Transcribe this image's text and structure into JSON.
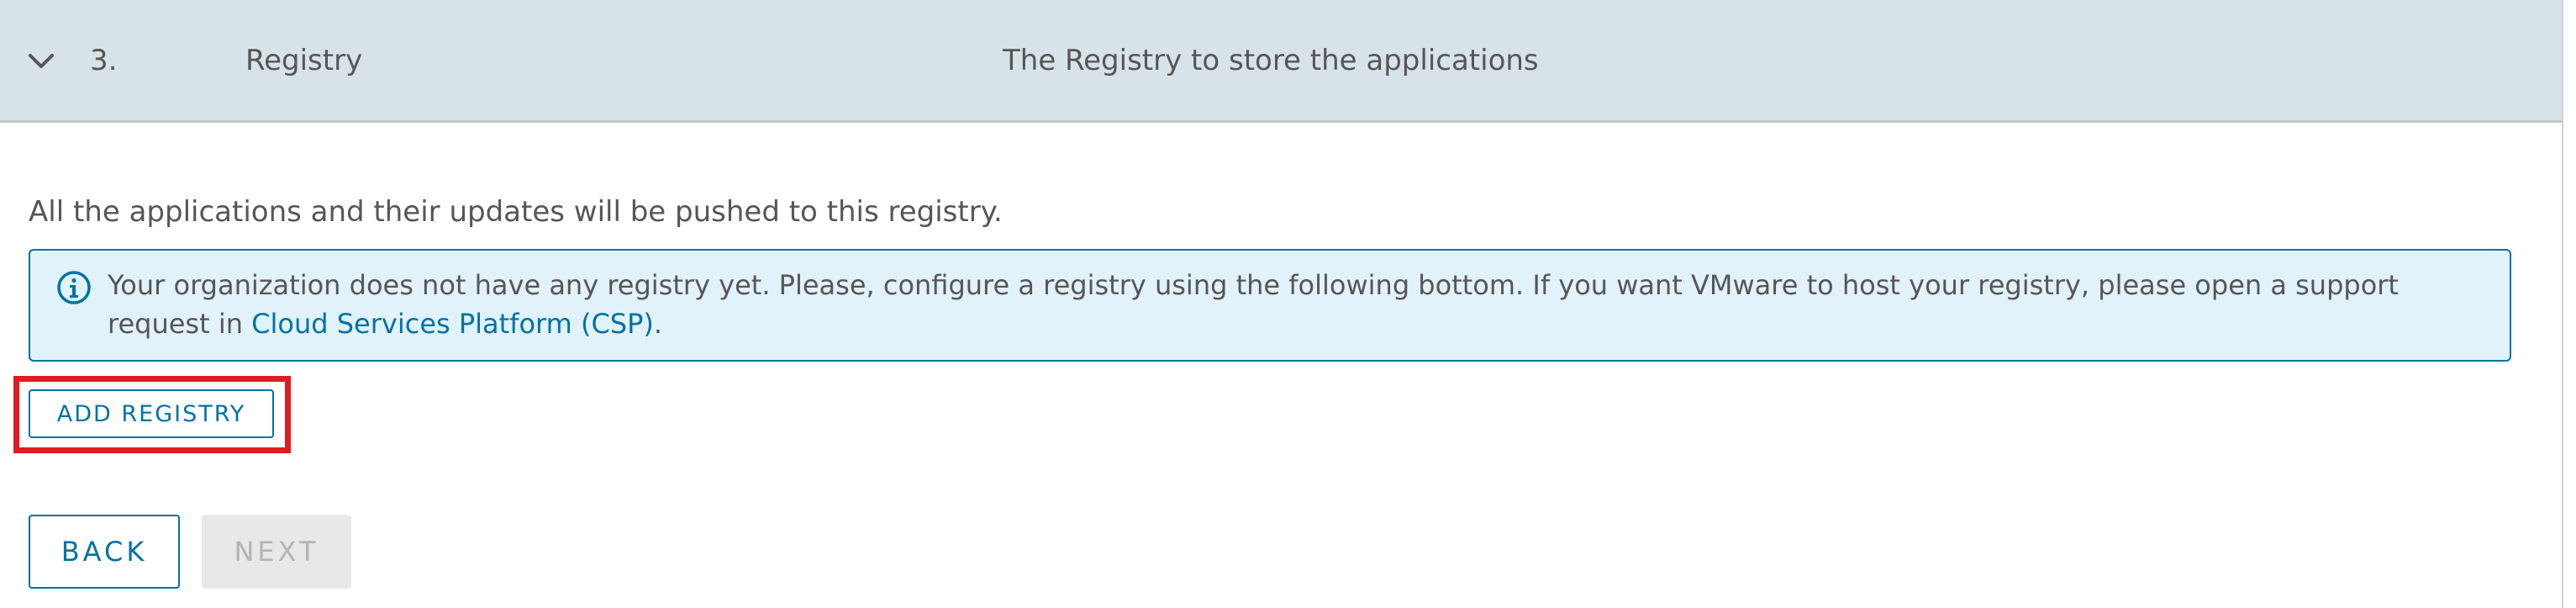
{
  "step": {
    "number": "3.",
    "title": "Registry",
    "description": "The Registry to store the applications",
    "expanded": true
  },
  "body": {
    "intro": "All the applications and their updates will be pushed to this registry.",
    "alert": {
      "type": "info",
      "text_before_link": "Your organization does not have any registry yet. Please, configure a registry using the following bottom. If you want VMware to host your registry, please open a support request in ",
      "link_text": "Cloud Services Platform (CSP)",
      "text_after_link": "."
    },
    "add_registry_label": "ADD REGISTRY"
  },
  "footer": {
    "back_label": "BACK",
    "next_label": "NEXT",
    "next_disabled": true
  },
  "colors": {
    "header_bg": "#d8e3e9",
    "accent": "#0072a3",
    "alert_bg": "#e1f2fb",
    "highlight": "#e01b22",
    "disabled_bg": "#e8e8e8",
    "text": "#565656"
  },
  "icons": {
    "expand": "chevron-down-icon",
    "alert": "info-circle-icon"
  }
}
